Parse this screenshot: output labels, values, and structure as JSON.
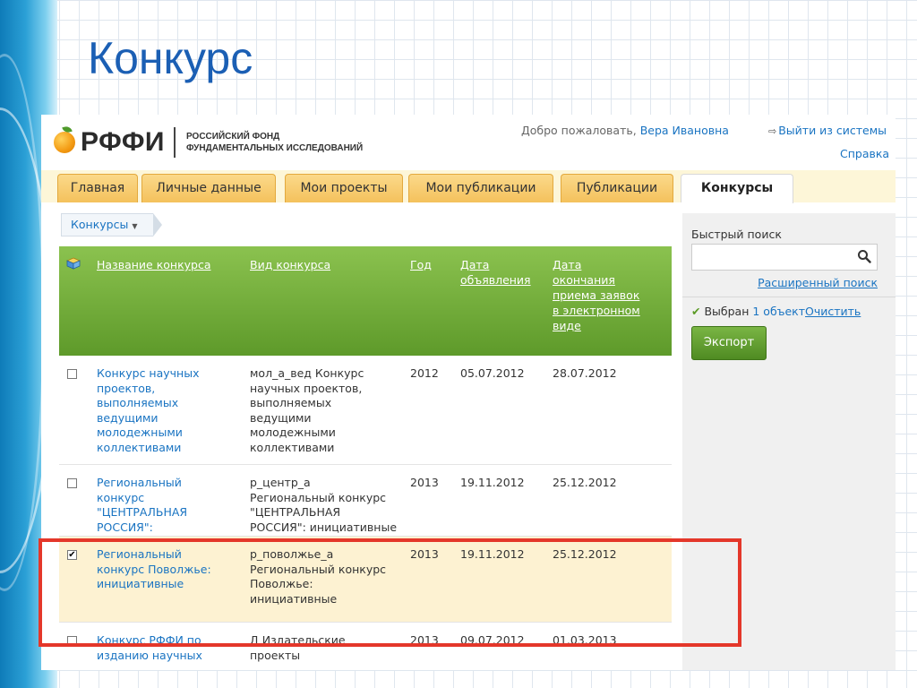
{
  "slide": {
    "title": "Конкурс"
  },
  "header": {
    "logo_text": "РФФИ",
    "logo_sub_1": "Российский фонд",
    "logo_sub_2": "фундаментальных исследований",
    "welcome_prefix": "Добро пожаловать,",
    "user_name": "Вера Ивановна",
    "logout": "Выйти из системы",
    "help": "Справка"
  },
  "tabs": [
    {
      "label": "Главная"
    },
    {
      "label": "Личные данные"
    },
    {
      "label": "Мои проекты"
    },
    {
      "label": "Мои публикации"
    },
    {
      "label": "Публикации"
    },
    {
      "label": "Конкурсы",
      "active": true
    }
  ],
  "breadcrumb": "Конкурсы",
  "table": {
    "headers": {
      "name": "Название конкурса",
      "type": "Вид конкурса",
      "year": "Год",
      "announced": "Дата объявления",
      "deadline": "Дата окончания приема заявок в электронном виде"
    },
    "rows": [
      {
        "checked": false,
        "name": "Конкурс научных проектов, выполняемых ведущими молодежными коллективами",
        "type": "мол_а_вед Конкурс научных проектов, выполняемых ведущими молодежными коллективами",
        "year": "2012",
        "announced": "05.07.2012",
        "deadline": "28.07.2012"
      },
      {
        "checked": false,
        "name": "Региональный конкурс \"ЦЕНТРАЛЬНАЯ РОССИЯ\": инициативные",
        "type": "р_центр_а Региональный конкурс \"ЦЕНТРАЛЬНАЯ РОССИЯ\": инициативные",
        "year": "2013",
        "announced": "19.11.2012",
        "deadline": "25.12.2012"
      },
      {
        "checked": true,
        "name": "Региональный конкурс Поволжье: инициативные",
        "type": "р_поволжье_а Региональный конкурс Поволжье: инициативные",
        "year": "2013",
        "announced": "19.11.2012",
        "deadline": "25.12.2012"
      },
      {
        "checked": false,
        "name": "Конкурс РФФИ по изданию научных",
        "type": "Д Издательские проекты",
        "year": "2013",
        "announced": "09.07.2012",
        "deadline": "01.03.2013"
      }
    ]
  },
  "side": {
    "quick_search": "Быстрый поиск",
    "search_value": "",
    "advanced_search": "Расширенный поиск",
    "selected_label": "Выбран",
    "selected_count": "1 объект",
    "clear": "Очистить",
    "export": "Экспорт"
  },
  "colors": {
    "title": "#1b5fb4",
    "link": "#1a74c2",
    "header_green": "#6fa83a",
    "tab_orange": "#f4c15c",
    "highlight": "#e4372a"
  }
}
